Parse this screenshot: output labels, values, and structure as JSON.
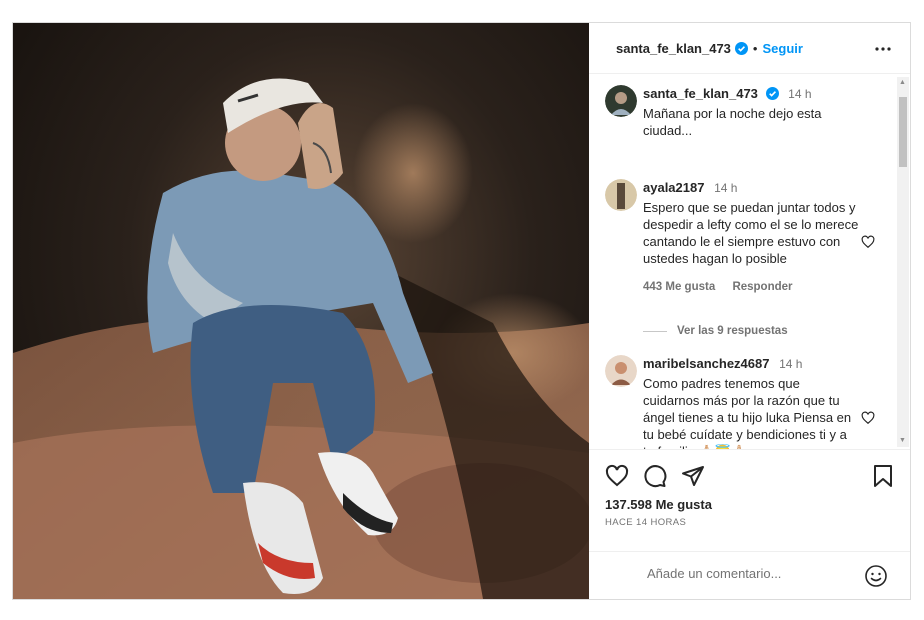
{
  "post": {
    "author": "santa_fe_klan_473",
    "follow_label": "Seguir",
    "separator": "•"
  },
  "caption": {
    "user": "santa_fe_klan_473",
    "time": "14 h",
    "text": "Mañana por la noche dejo esta ciudad..."
  },
  "comments": [
    {
      "user": "ayala2187",
      "time": "14 h",
      "text": "Espero que se puedan juntar todos y despedir a lefty como el se lo merece cantando le el siempre estuvo con ustedes hagan lo posible",
      "likes": "443 Me gusta",
      "reply": "Responder",
      "view_replies": "Ver las 9 respuestas"
    },
    {
      "user": "maribelsanchez4687",
      "time": "14 h",
      "text": "Como padres tenemos que cuidarnos más por la razón que tu ángel tienes a tu hijo luka Piensa en tu bebé cuídate y bendiciones ti y a tu familia 🙏🏻😇🙏🏻"
    }
  ],
  "stats": {
    "likes": "137.598 Me gusta",
    "ago": "HACE 14 HORAS"
  },
  "composer": {
    "placeholder": "Añade un comentario..."
  },
  "icons": {
    "verified": "verified-badge-icon",
    "more": "more-options-icon",
    "like": "heart-icon",
    "comment": "comment-icon",
    "share": "share-icon",
    "save": "bookmark-icon",
    "emoji": "emoji-icon"
  },
  "colors": {
    "link": "#0095f6",
    "verified": "#0095f6",
    "secondary_text": "#737373"
  }
}
